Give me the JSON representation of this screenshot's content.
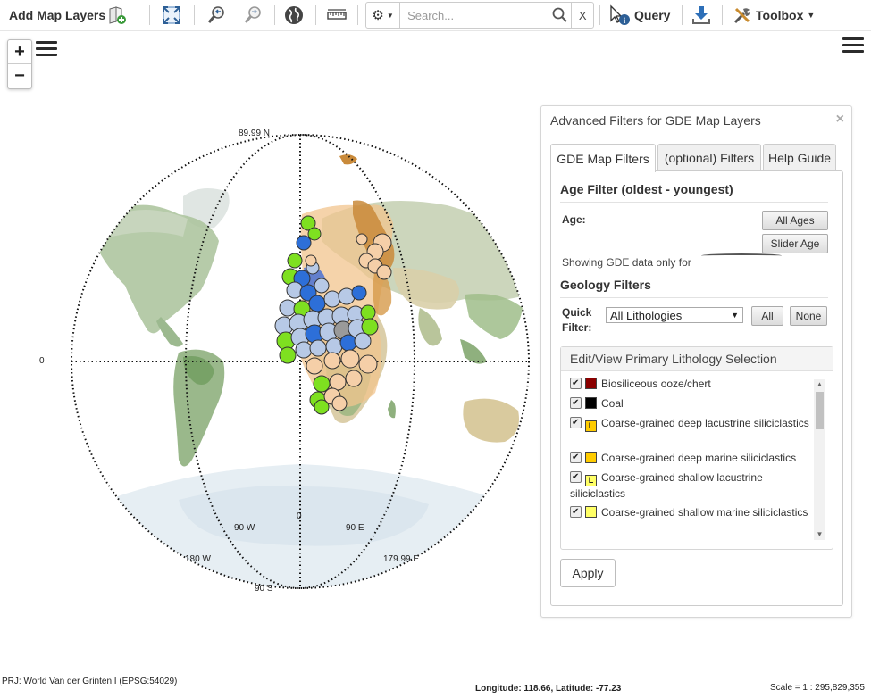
{
  "toolbar": {
    "add_map_layers": "Add Map Layers",
    "search_placeholder": "Search...",
    "clear_label": "X",
    "query_label": "Query",
    "toolbox_label": "Toolbox"
  },
  "map_controls": {
    "zoom_in": "+",
    "zoom_out": "−"
  },
  "map": {
    "labels": {
      "top": "89.99 N",
      "bottom": "90 S",
      "left_zero": "0",
      "bottom_zero": "0",
      "w90": "90 W",
      "e90": "90 E",
      "w180": "180 W",
      "e180": "179.99 E"
    }
  },
  "panel": {
    "title": "Advanced Filters for GDE Map Layers",
    "close": "×",
    "tabs": [
      "GDE Map Filters",
      "(optional) Filters",
      "Help Guide"
    ],
    "age_filter_heading": "Age Filter (oldest - youngest)",
    "age_label": "Age:",
    "all_ages_button": "All Ages",
    "slider_age_button": "Slider Age",
    "showing_text": "Showing GDE data only for",
    "geology_heading": "Geology Filters",
    "quick_filter_label_1": "Quick",
    "quick_filter_label_2": "Filter:",
    "quick_filter_value": "All Lithologies",
    "all_button": "All",
    "none_button": "None",
    "lithology_heading": "Edit/View Primary Lithology Selection",
    "lithologies": [
      {
        "label": "Biosiliceous ooze/chert",
        "color": "#8b0000",
        "letter": ""
      },
      {
        "label": "Coal",
        "color": "#000000",
        "letter": ""
      },
      {
        "label": "Coarse-grained deep lacustrine siliciclastics",
        "color": "#ffcc00",
        "letter": "L"
      },
      {
        "label": "Coarse-grained deep marine siliciclastics",
        "color": "#ffcc00",
        "letter": ""
      },
      {
        "label": "Coarse-grained shallow lacustrine siliciclastics",
        "color": "#ffff66",
        "letter": "L"
      },
      {
        "label": "Coarse-grained shallow marine siliciclastics",
        "color": "#ffff66",
        "letter": ""
      }
    ],
    "apply_button": "Apply"
  },
  "status": {
    "projection": "PRJ: World Van der Grinten I (EPSG:54029)",
    "coords": "Longitude: 118.66, Latitude: -77.23",
    "scale": "Scale = 1 : 295,829,355"
  }
}
